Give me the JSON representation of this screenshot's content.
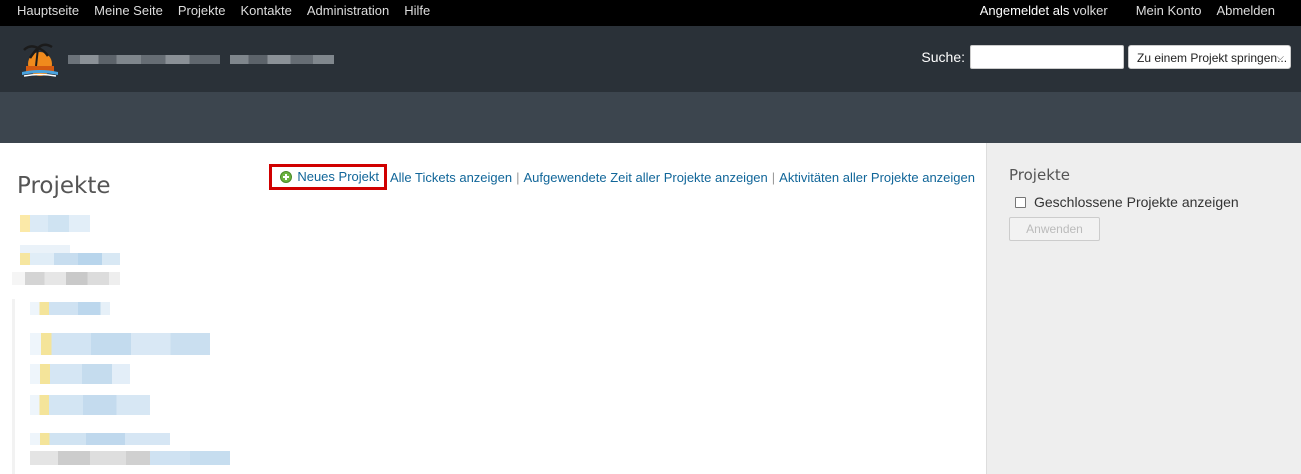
{
  "top_menu": {
    "items": [
      "Hauptseite",
      "Meine Seite",
      "Projekte",
      "Kontakte",
      "Administration",
      "Hilfe"
    ],
    "logged_as": "Angemeldet als",
    "user": "volker",
    "account": [
      "Mein Konto",
      "Abmelden"
    ]
  },
  "header": {
    "search_label": "Suche:",
    "project_jump": "Zu einem Projekt springen..."
  },
  "content": {
    "title": "Projekte",
    "new_project": "Neues Projekt",
    "links": [
      "Alle Tickets anzeigen",
      "Aufgewendete Zeit aller Projekte anzeigen",
      "Aktivitäten aller Projekte anzeigen"
    ]
  },
  "sidebar": {
    "title": "Projekte",
    "closed_label": "Geschlossene Projekte anzeigen",
    "apply": "Anwenden"
  },
  "colors": {
    "top_bar": "#000000",
    "header": "#2a3138",
    "main_menu": "#3c454e",
    "link": "#116699",
    "highlight_box": "#d00000",
    "sidebar_bg": "#eeeeee"
  }
}
